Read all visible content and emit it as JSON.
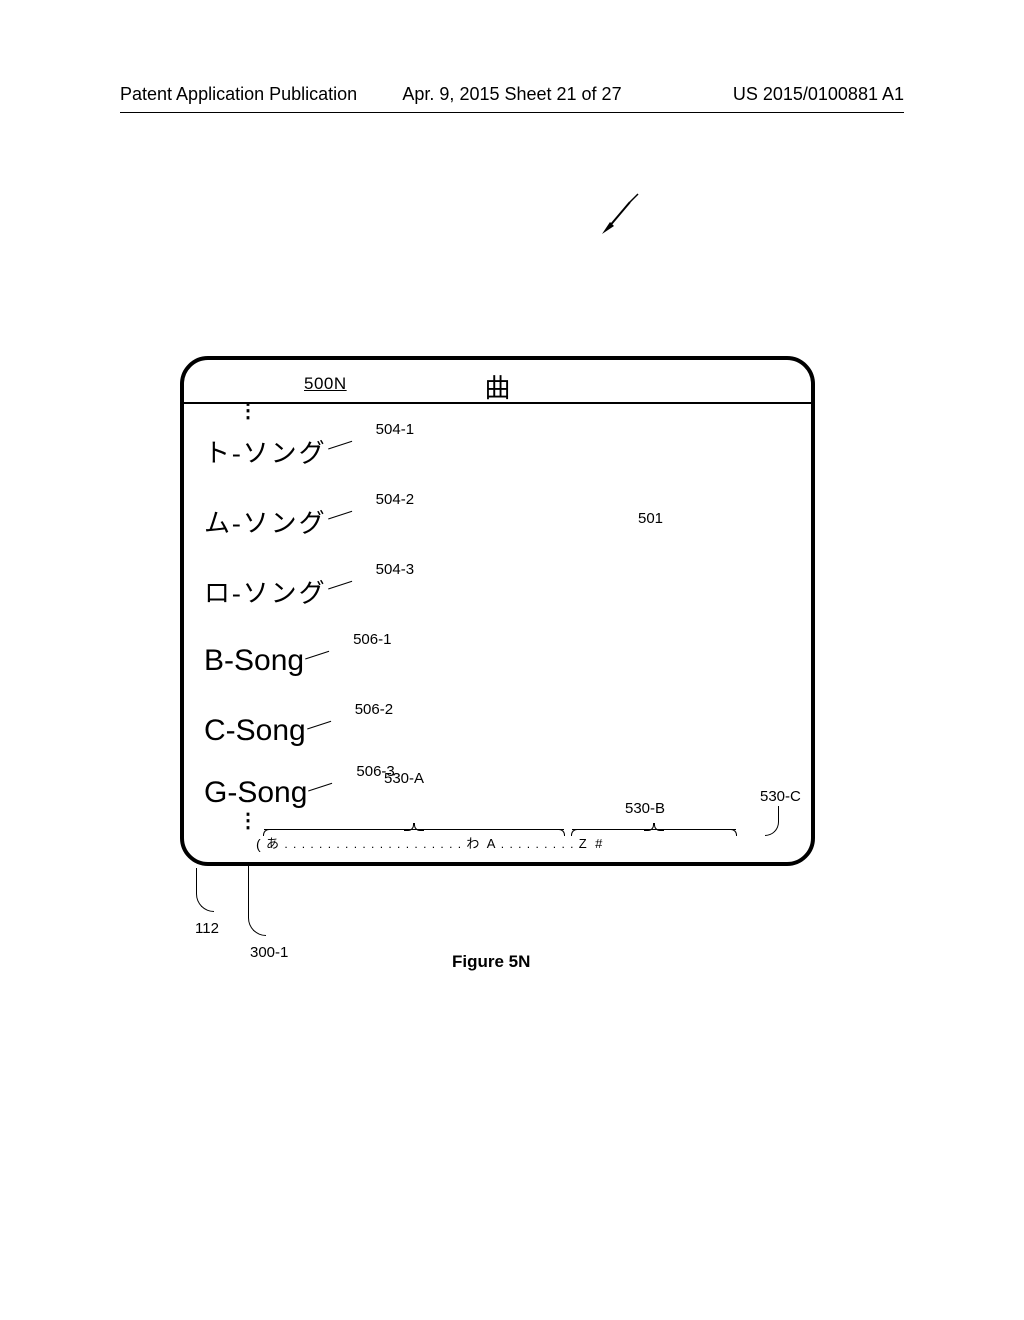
{
  "header": {
    "left": "Patent Application Publication",
    "center": "Apr. 9, 2015  Sheet 21 of 27",
    "right": "US 2015/0100881 A1"
  },
  "figure": {
    "label": "500N",
    "title_jp": "曲",
    "caption": "Figure 5N"
  },
  "refs": {
    "r501": "501",
    "r504_1": "504-1",
    "r504_2": "504-2",
    "r504_3": "504-3",
    "r506_1": "506-1",
    "r506_2": "506-2",
    "r506_3": "506-3",
    "r530_A": "530-A",
    "r530_B": "530-B",
    "r530_C": "530-C",
    "r112": "112",
    "r300_1": "300-1"
  },
  "songs": {
    "jp1": "ト-ソング",
    "jp2": "ム-ソング",
    "jp3": "ロ-ソング",
    "en1": "B-Song",
    "en2": "C-Song",
    "en3": "G-Song"
  },
  "scrub": {
    "start_jp": "あ",
    "end_jp": "わ",
    "start_en": "A",
    "end_en": "Z",
    "hash": "#"
  },
  "vdots": "⋮"
}
